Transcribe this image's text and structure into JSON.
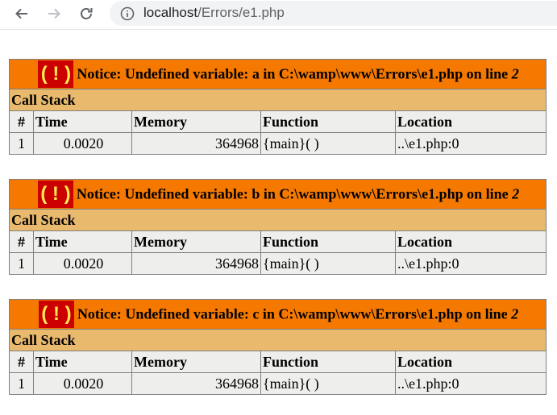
{
  "browser": {
    "url_host": "localhost",
    "url_path": "/Errors/e1.php"
  },
  "errors": [
    {
      "bang": "( ! )",
      "message": "Notice: Undefined variable: a in C:\\wamp\\www\\Errors\\e1.php on line ",
      "line": "2",
      "callstack_label": "Call Stack",
      "headers": [
        "#",
        "Time",
        "Memory",
        "Function",
        "Location"
      ],
      "row": [
        "1",
        "0.0020",
        "364968",
        "{main}( )",
        "..\\e1.php:0"
      ]
    },
    {
      "bang": "( ! )",
      "message": "Notice: Undefined variable: b in C:\\wamp\\www\\Errors\\e1.php on line ",
      "line": "2",
      "callstack_label": "Call Stack",
      "headers": [
        "#",
        "Time",
        "Memory",
        "Function",
        "Location"
      ],
      "row": [
        "1",
        "0.0020",
        "364968",
        "{main}( )",
        "..\\e1.php:0"
      ]
    },
    {
      "bang": "( ! )",
      "message": "Notice: Undefined variable: c in C:\\wamp\\www\\Errors\\e1.php on line ",
      "line": "2",
      "callstack_label": "Call Stack",
      "headers": [
        "#",
        "Time",
        "Memory",
        "Function",
        "Location"
      ],
      "row": [
        "1",
        "0.0020",
        "364968",
        "{main}( )",
        "..\\e1.php:0"
      ]
    }
  ],
  "colors": {
    "notice_bg": "#f57900",
    "bang_bg": "#cc0000",
    "bang_fg": "#fce94f",
    "callstack_bg": "#e9b96e",
    "cell_bg": "#eeeeec"
  }
}
